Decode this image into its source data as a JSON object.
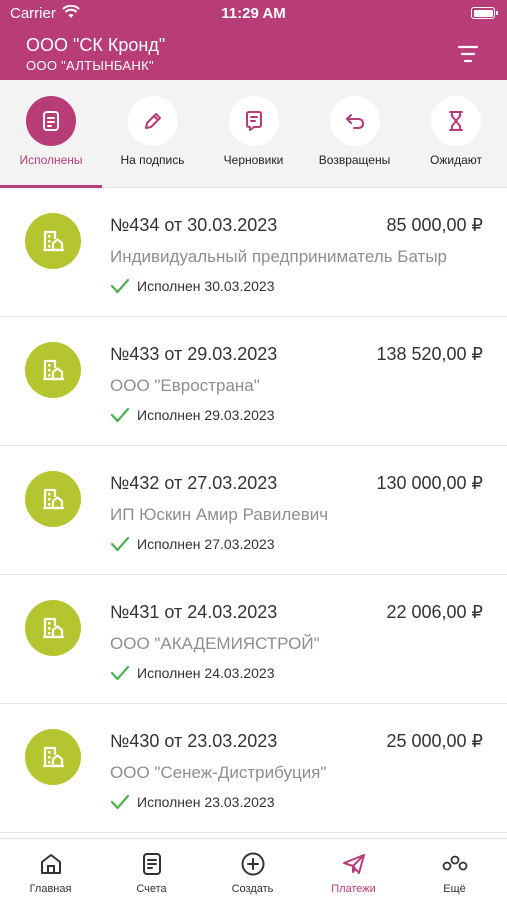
{
  "status_bar": {
    "carrier": "Carrier",
    "time": "11:29 AM"
  },
  "header": {
    "company": "ООО \"СК Кронд\"",
    "bank": "ООО \"АЛТЫНБАНК\"",
    "icon": "filter-icon"
  },
  "tabs": [
    {
      "label": "Исполнены",
      "icon": "document-icon",
      "active": true
    },
    {
      "label": "На подпись",
      "icon": "pen-icon",
      "active": false
    },
    {
      "label": "Черновики",
      "icon": "draft-icon",
      "active": false
    },
    {
      "label": "Возвращены",
      "icon": "return-icon",
      "active": false
    },
    {
      "label": "Ожидают",
      "icon": "hourglass-icon",
      "active": false
    }
  ],
  "payments": [
    {
      "number": "№434 от 30.03.2023",
      "amount": "85 000,00 ₽",
      "payee": "Индивидуальный предприниматель Батыр",
      "status": "Исполнен 30.03.2023"
    },
    {
      "number": "№433 от 29.03.2023",
      "amount": "138 520,00 ₽",
      "payee": "ООО \"Евространа\"",
      "status": "Исполнен 29.03.2023"
    },
    {
      "number": "№432 от 27.03.2023",
      "amount": "130 000,00 ₽",
      "payee": "ИП Юскин Амир Равилевич",
      "status": "Исполнен 27.03.2023"
    },
    {
      "number": "№431 от 24.03.2023",
      "amount": "22 006,00 ₽",
      "payee": "ООО \"АКАДЕМИЯСТРОЙ\"",
      "status": "Исполнен 24.03.2023"
    },
    {
      "number": "№430 от 23.03.2023",
      "amount": "25 000,00 ₽",
      "payee": "ООО \"Сенеж-Дистрибуция\"",
      "status": "Исполнен 23.03.2023"
    }
  ],
  "bottom_nav": [
    {
      "label": "Главная",
      "icon": "home-icon",
      "active": false
    },
    {
      "label": "Счета",
      "icon": "accounts-icon",
      "active": false
    },
    {
      "label": "Создать",
      "icon": "plus-circle-icon",
      "active": false
    },
    {
      "label": "Платежи",
      "icon": "send-icon",
      "active": true
    },
    {
      "label": "Ещё",
      "icon": "more-icon",
      "active": false
    }
  ],
  "colors": {
    "brand": "#b83c77",
    "avatar": "#b5c530",
    "check": "#4caf50"
  }
}
